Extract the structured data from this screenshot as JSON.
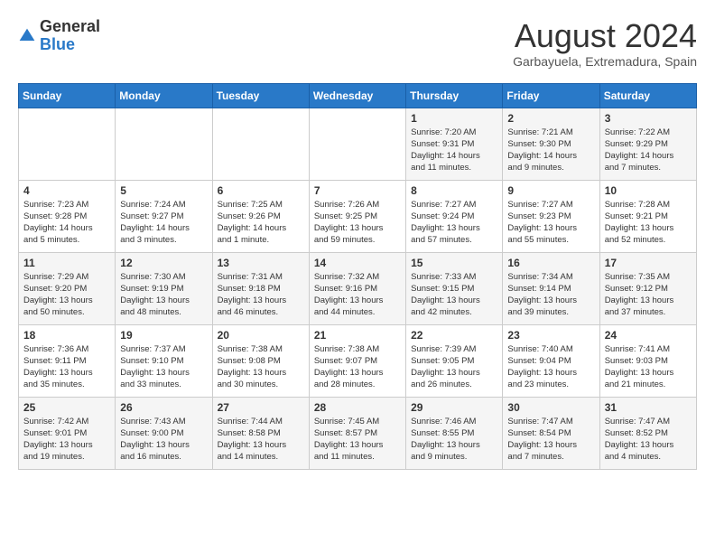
{
  "header": {
    "logo_general": "General",
    "logo_blue": "Blue",
    "month_title": "August 2024",
    "location": "Garbayuela, Extremadura, Spain"
  },
  "weekdays": [
    "Sunday",
    "Monday",
    "Tuesday",
    "Wednesday",
    "Thursday",
    "Friday",
    "Saturday"
  ],
  "weeks": [
    [
      {
        "day": "",
        "info": ""
      },
      {
        "day": "",
        "info": ""
      },
      {
        "day": "",
        "info": ""
      },
      {
        "day": "",
        "info": ""
      },
      {
        "day": "1",
        "info": "Sunrise: 7:20 AM\nSunset: 9:31 PM\nDaylight: 14 hours\nand 11 minutes."
      },
      {
        "day": "2",
        "info": "Sunrise: 7:21 AM\nSunset: 9:30 PM\nDaylight: 14 hours\nand 9 minutes."
      },
      {
        "day": "3",
        "info": "Sunrise: 7:22 AM\nSunset: 9:29 PM\nDaylight: 14 hours\nand 7 minutes."
      }
    ],
    [
      {
        "day": "4",
        "info": "Sunrise: 7:23 AM\nSunset: 9:28 PM\nDaylight: 14 hours\nand 5 minutes."
      },
      {
        "day": "5",
        "info": "Sunrise: 7:24 AM\nSunset: 9:27 PM\nDaylight: 14 hours\nand 3 minutes."
      },
      {
        "day": "6",
        "info": "Sunrise: 7:25 AM\nSunset: 9:26 PM\nDaylight: 14 hours\nand 1 minute."
      },
      {
        "day": "7",
        "info": "Sunrise: 7:26 AM\nSunset: 9:25 PM\nDaylight: 13 hours\nand 59 minutes."
      },
      {
        "day": "8",
        "info": "Sunrise: 7:27 AM\nSunset: 9:24 PM\nDaylight: 13 hours\nand 57 minutes."
      },
      {
        "day": "9",
        "info": "Sunrise: 7:27 AM\nSunset: 9:23 PM\nDaylight: 13 hours\nand 55 minutes."
      },
      {
        "day": "10",
        "info": "Sunrise: 7:28 AM\nSunset: 9:21 PM\nDaylight: 13 hours\nand 52 minutes."
      }
    ],
    [
      {
        "day": "11",
        "info": "Sunrise: 7:29 AM\nSunset: 9:20 PM\nDaylight: 13 hours\nand 50 minutes."
      },
      {
        "day": "12",
        "info": "Sunrise: 7:30 AM\nSunset: 9:19 PM\nDaylight: 13 hours\nand 48 minutes."
      },
      {
        "day": "13",
        "info": "Sunrise: 7:31 AM\nSunset: 9:18 PM\nDaylight: 13 hours\nand 46 minutes."
      },
      {
        "day": "14",
        "info": "Sunrise: 7:32 AM\nSunset: 9:16 PM\nDaylight: 13 hours\nand 44 minutes."
      },
      {
        "day": "15",
        "info": "Sunrise: 7:33 AM\nSunset: 9:15 PM\nDaylight: 13 hours\nand 42 minutes."
      },
      {
        "day": "16",
        "info": "Sunrise: 7:34 AM\nSunset: 9:14 PM\nDaylight: 13 hours\nand 39 minutes."
      },
      {
        "day": "17",
        "info": "Sunrise: 7:35 AM\nSunset: 9:12 PM\nDaylight: 13 hours\nand 37 minutes."
      }
    ],
    [
      {
        "day": "18",
        "info": "Sunrise: 7:36 AM\nSunset: 9:11 PM\nDaylight: 13 hours\nand 35 minutes."
      },
      {
        "day": "19",
        "info": "Sunrise: 7:37 AM\nSunset: 9:10 PM\nDaylight: 13 hours\nand 33 minutes."
      },
      {
        "day": "20",
        "info": "Sunrise: 7:38 AM\nSunset: 9:08 PM\nDaylight: 13 hours\nand 30 minutes."
      },
      {
        "day": "21",
        "info": "Sunrise: 7:38 AM\nSunset: 9:07 PM\nDaylight: 13 hours\nand 28 minutes."
      },
      {
        "day": "22",
        "info": "Sunrise: 7:39 AM\nSunset: 9:05 PM\nDaylight: 13 hours\nand 26 minutes."
      },
      {
        "day": "23",
        "info": "Sunrise: 7:40 AM\nSunset: 9:04 PM\nDaylight: 13 hours\nand 23 minutes."
      },
      {
        "day": "24",
        "info": "Sunrise: 7:41 AM\nSunset: 9:03 PM\nDaylight: 13 hours\nand 21 minutes."
      }
    ],
    [
      {
        "day": "25",
        "info": "Sunrise: 7:42 AM\nSunset: 9:01 PM\nDaylight: 13 hours\nand 19 minutes."
      },
      {
        "day": "26",
        "info": "Sunrise: 7:43 AM\nSunset: 9:00 PM\nDaylight: 13 hours\nand 16 minutes."
      },
      {
        "day": "27",
        "info": "Sunrise: 7:44 AM\nSunset: 8:58 PM\nDaylight: 13 hours\nand 14 minutes."
      },
      {
        "day": "28",
        "info": "Sunrise: 7:45 AM\nSunset: 8:57 PM\nDaylight: 13 hours\nand 11 minutes."
      },
      {
        "day": "29",
        "info": "Sunrise: 7:46 AM\nSunset: 8:55 PM\nDaylight: 13 hours\nand 9 minutes."
      },
      {
        "day": "30",
        "info": "Sunrise: 7:47 AM\nSunset: 8:54 PM\nDaylight: 13 hours\nand 7 minutes."
      },
      {
        "day": "31",
        "info": "Sunrise: 7:47 AM\nSunset: 8:52 PM\nDaylight: 13 hours\nand 4 minutes."
      }
    ]
  ]
}
